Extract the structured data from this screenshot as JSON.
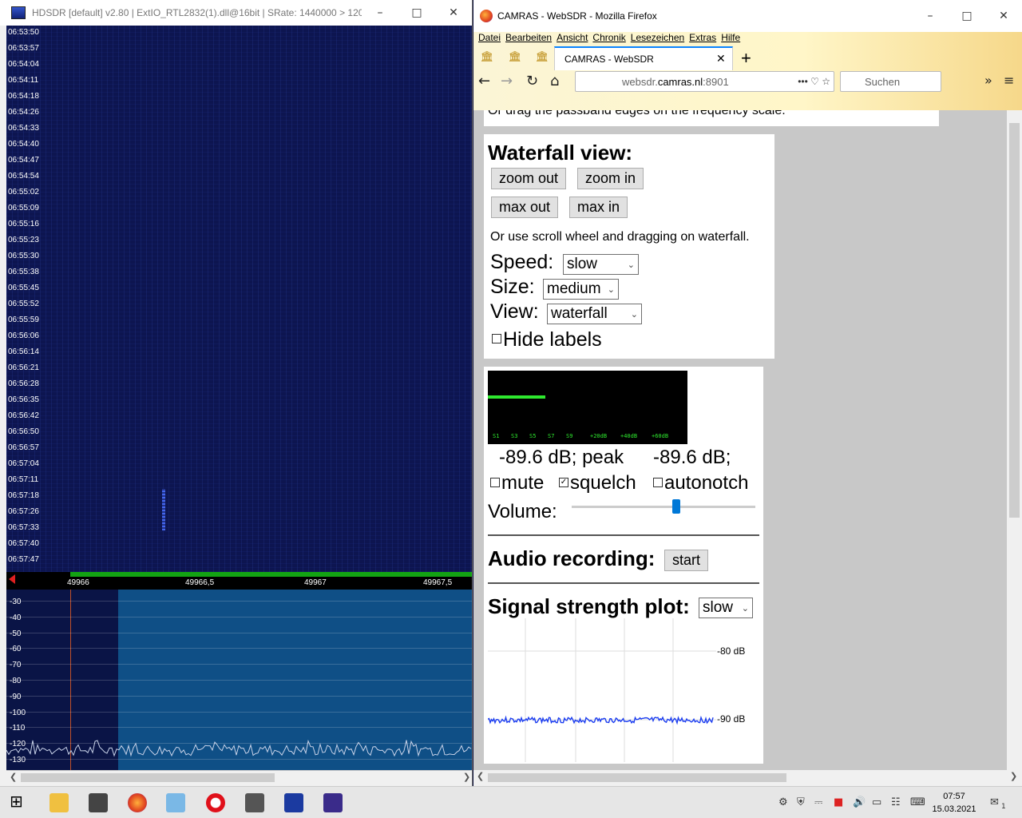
{
  "hdsdr": {
    "title": "HDSDR  [default]  v2.80   |  ExtIO_RTL2832(1).dll@16bit  |  SRate: 1440000 > 120...",
    "time_labels": [
      "06:53:50",
      "06:53:57",
      "06:54:04",
      "06:54:11",
      "06:54:18",
      "06:54:26",
      "06:54:33",
      "06:54:40",
      "06:54:47",
      "06:54:54",
      "06:55:02",
      "06:55:09",
      "06:55:16",
      "06:55:23",
      "06:55:30",
      "06:55:38",
      "06:55:45",
      "06:55:52",
      "06:55:59",
      "06:56:06",
      "06:56:14",
      "06:56:21",
      "06:56:28",
      "06:56:35",
      "06:56:42",
      "06:56:50",
      "06:56:57",
      "06:57:04",
      "06:57:11",
      "06:57:18",
      "06:57:26",
      "06:57:33",
      "06:57:40",
      "06:57:47"
    ],
    "freq_labels": [
      "49966",
      "49966,5",
      "49967",
      "49967,5"
    ],
    "db_labels": [
      "-30",
      "-40",
      "-50",
      "-60",
      "-70",
      "-80",
      "-90",
      "-100",
      "-110",
      "-120",
      "-130"
    ]
  },
  "firefox": {
    "title": "CAMRAS - WebSDR - Mozilla Firefox",
    "menu": [
      "Datei",
      "Bearbeiten",
      "Ansicht",
      "Chronik",
      "Lesezeichen",
      "Extras",
      "Hilfe"
    ],
    "tab_label": "CAMRAS - WebSDR",
    "url_prefix": "websdr.",
    "url_host": "camras.nl",
    "url_suffix": ":8901",
    "search_placeholder": "Suchen"
  },
  "page": {
    "top_text": "Or drag the passband edges on the frequency scale.",
    "waterfall_heading": "Waterfall view:",
    "btn_zoom_out": "zoom out",
    "btn_zoom_in": "zoom in",
    "btn_max_out": "max out",
    "btn_max_in": "max in",
    "scroll_hint": "Or use scroll wheel and dragging on waterfall.",
    "speed_label": "Speed:",
    "speed_value": "slow",
    "size_label": "Size:",
    "size_value": "medium",
    "view_label": "View:",
    "view_value": "waterfall",
    "hide_labels": "Hide labels",
    "smeter_labels": [
      "S1",
      "S3",
      "S5",
      "S7",
      "S9",
      "+20dB",
      "+40dB",
      "+60dB"
    ],
    "level_text": "-89.6 dB; peak",
    "peak_text": "-89.6 dB;",
    "mute": "mute",
    "squelch": "squelch",
    "autonotch": "autonotch",
    "volume_label": "Volume:",
    "volume_level": 0.57,
    "recording_heading": "Audio recording:",
    "btn_start": "start",
    "signal_heading": "Signal strength plot:",
    "signal_speed": "slow",
    "plot_label_80": "-80 dB",
    "plot_label_90": "-90 dB"
  },
  "taskbar": {
    "time": "07:57",
    "date": "15.03.2021",
    "notifications": "1"
  }
}
